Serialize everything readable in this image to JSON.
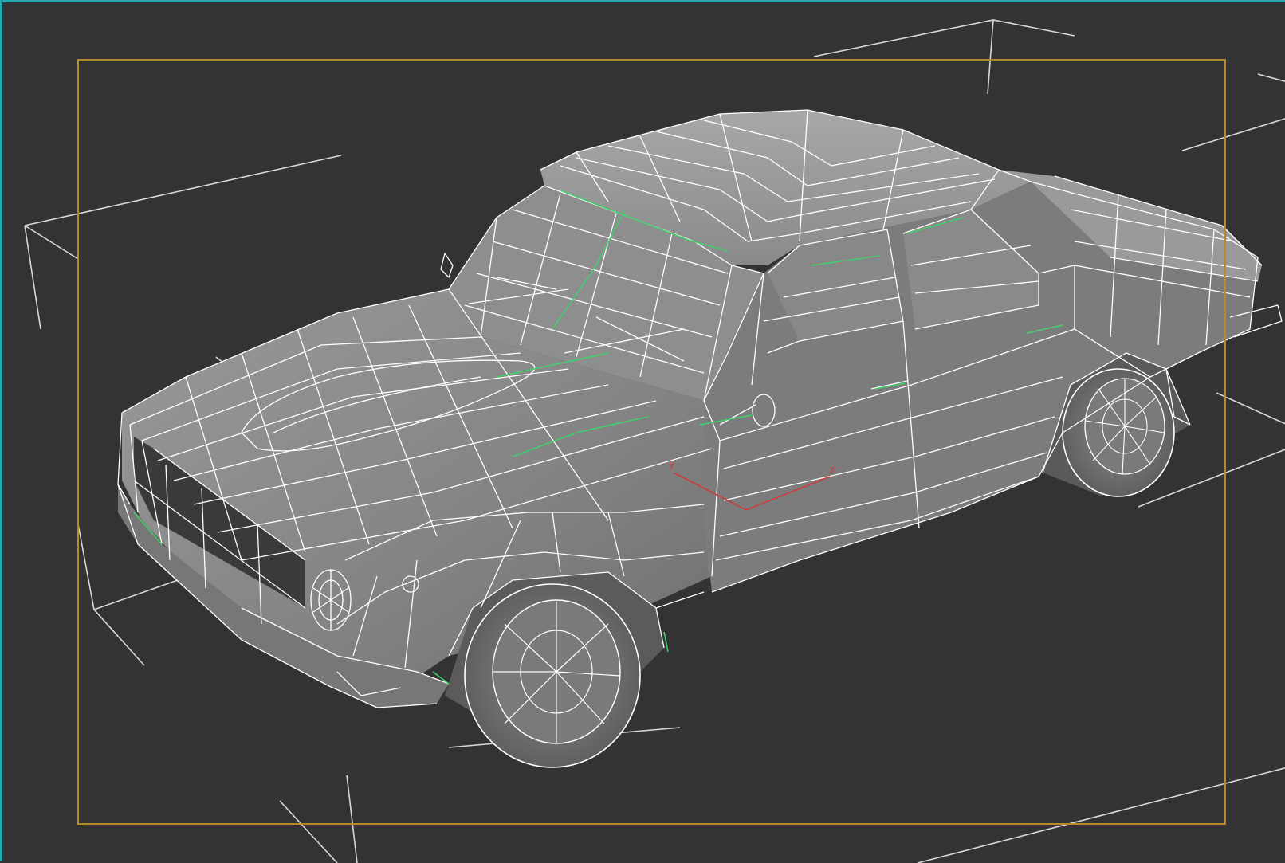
{
  "viewport": {
    "background_color": "#333333",
    "active_border_color": "#2aa8b0",
    "safe_frame_color": "#b88a2a",
    "wire_color": "#ffffff",
    "edge_highlight_color": "#3fd06a",
    "gizmo_color": "#d23a3a",
    "body_shade_color": "#8c8c8c"
  },
  "scene": {
    "object": "car-sedan-wireframe",
    "gizmo": {
      "x_label": "x",
      "y_label": "y"
    }
  }
}
